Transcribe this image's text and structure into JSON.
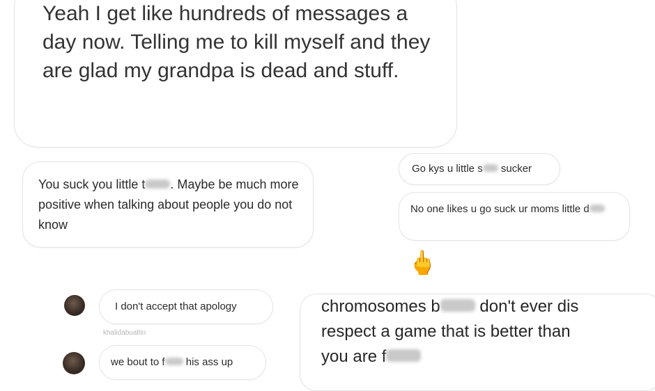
{
  "messages": {
    "m1": {
      "text": "Yeah I get like hundreds of messages a day now. Telling me to kill myself and they are glad my grandpa is dead and stuff."
    },
    "m2": {
      "before": "You suck you little t",
      "after": ". Maybe be much more positive when talking about people you do not know"
    },
    "m3": {
      "before": "Go kys u little s",
      "after": " sucker"
    },
    "m4": {
      "text": "No one likes u go suck ur moms little d"
    },
    "m5": {
      "text": "I don't accept that apology",
      "username": "khalidabualtin"
    },
    "m6": {
      "before": "we bout to f",
      "after": " his ass up"
    },
    "m7": {
      "line1_before": "chromosomes b",
      "line1_after": " don't ever dis",
      "line2": "respect a game that is better than",
      "line3": "you are f"
    }
  },
  "emoji": {
    "middle_finger": "🖕"
  },
  "icons": {
    "avatar_1": "user-avatar",
    "avatar_2": "user-avatar"
  },
  "colors": {
    "bubble_border": "#e4e4e4",
    "text": "#262626",
    "username": "#b5b5b5",
    "censor_blur": "#c9c9c9"
  }
}
